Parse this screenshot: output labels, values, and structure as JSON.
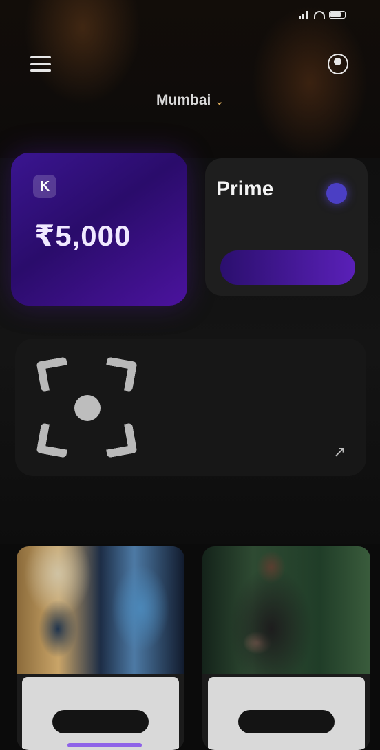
{
  "status_bar": {
    "time": "",
    "icons": [
      "signal-icon",
      "wifi-icon",
      "battery-icon"
    ]
  },
  "header": {
    "menu_icon": "menu-icon",
    "profile_icon": "profile-icon",
    "location_label": "Mumbai",
    "location_chevron": "⌄"
  },
  "promo_card": {
    "logo_glyph": "K",
    "title": "₹5,000",
    "subtitle": "",
    "link_text": "",
    "chip_text": ""
  },
  "offer_card": {
    "title": "Prime",
    "description": "",
    "button_label": ""
  },
  "scan_card": {
    "title": "",
    "description": "",
    "arrow": "↗"
  },
  "section": {
    "title": ""
  },
  "products": [
    {
      "button_label": ""
    },
    {
      "button_label": ""
    }
  ],
  "colors": {
    "accent_purple": "#4b139e",
    "button_purple": "#5a20b8",
    "background": "#0b0b0b",
    "location_chevron": "#d6a85a"
  }
}
